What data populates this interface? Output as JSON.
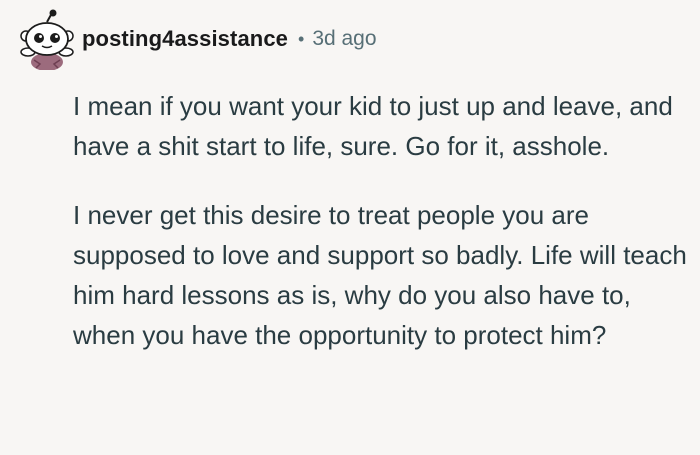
{
  "comment": {
    "username": "posting4assistance",
    "separator": "•",
    "timestamp": "3d ago",
    "avatar_icon": "snoo-avatar-icon",
    "paragraphs": [
      "I mean if you want your kid to just up and leave, and have a shit start to life, sure. Go for it, asshole.",
      "I never get this desire to treat people you are supposed to love and support so badly. Life will teach him hard lessons as is, why do you also have to, when you have the opportunity to protect him?"
    ]
  }
}
